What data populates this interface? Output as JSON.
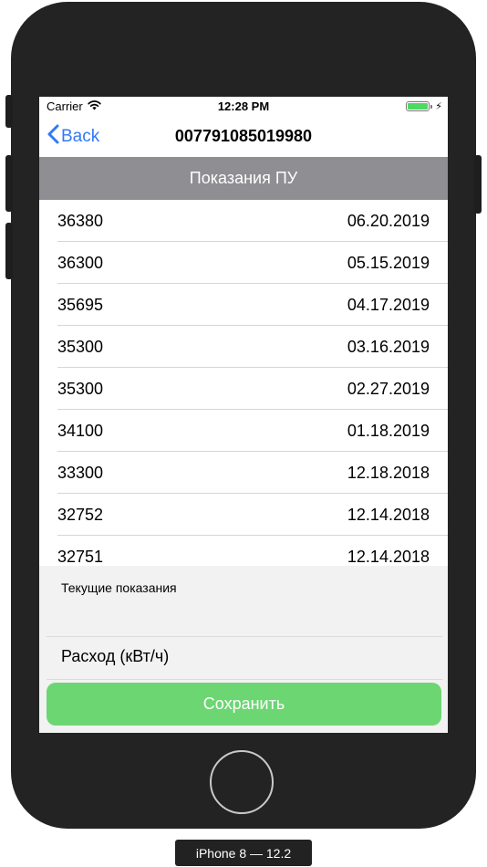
{
  "status_bar": {
    "carrier": "Carrier",
    "time": "12:28 PM",
    "wifi_icon": "wifi-icon",
    "battery_icon": "battery-icon",
    "battery_level": 1.0,
    "charging_icon": "bolt-icon",
    "battery_color": "#4cd964"
  },
  "nav": {
    "back_label": "Back",
    "back_icon": "chevron-left-icon",
    "title": "007791085019980",
    "accent_color": "#3478f6"
  },
  "section": {
    "title": "Показания ПУ",
    "background": "#8e8e93"
  },
  "readings": [
    {
      "value": "36380",
      "date": "06.20.2019"
    },
    {
      "value": "36300",
      "date": "05.15.2019"
    },
    {
      "value": "35695",
      "date": "04.17.2019"
    },
    {
      "value": "35300",
      "date": "03.16.2019"
    },
    {
      "value": "35300",
      "date": "02.27.2019"
    },
    {
      "value": "34100",
      "date": "01.18.2019"
    },
    {
      "value": "33300",
      "date": "12.18.2018"
    },
    {
      "value": "32752",
      "date": "12.14.2018"
    },
    {
      "value": "32751",
      "date": "12.14.2018"
    }
  ],
  "form": {
    "current_label": "Текущие показания",
    "consumption_label": "Расход (кВт/ч)",
    "save_label": "Сохранить",
    "save_color": "#6cd672"
  },
  "device": {
    "label": "iPhone 8 — 12.2"
  }
}
